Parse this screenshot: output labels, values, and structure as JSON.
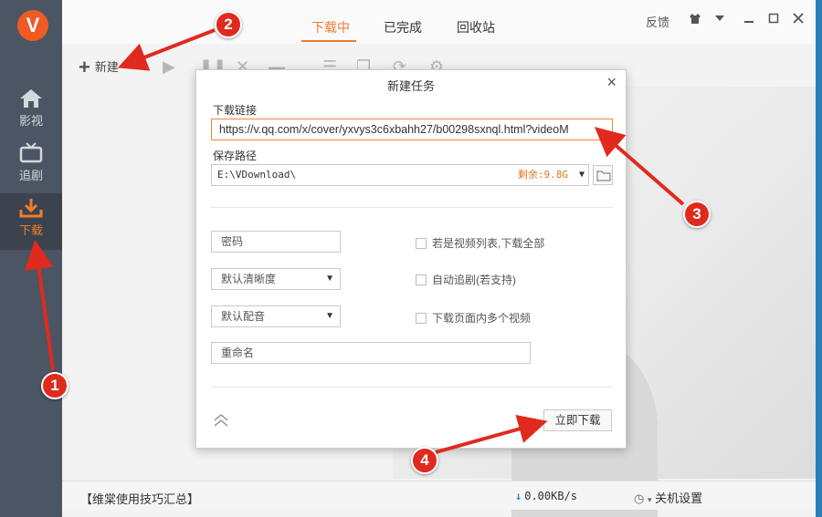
{
  "app": {
    "logo_text": "V",
    "sidebar": [
      {
        "label": "影视",
        "icon": "home-icon"
      },
      {
        "label": "追剧",
        "icon": "tv-icon"
      },
      {
        "label": "下载",
        "icon": "download-icon",
        "active": true
      }
    ],
    "tabs": [
      {
        "label": "下载中",
        "active": true
      },
      {
        "label": "已完成"
      },
      {
        "label": "回收站"
      }
    ],
    "feedback": "反馈",
    "toolbar": {
      "new_label": "新建"
    },
    "accent_color": "#f07c2b"
  },
  "dialog": {
    "title": "新建任务",
    "url_label": "下载链接",
    "url_value": "https://v.qq.com/x/cover/yxvys3c6xbahh27/b00298sxnql.html?videoM",
    "path_label": "保存路径",
    "path_value": "E:\\VDownload\\",
    "free_space": "剩余:9.8G",
    "password_placeholder": "密码",
    "quality_select": "默认清晰度",
    "audio_select": "默认配音",
    "rename_placeholder": "重命名",
    "checkbox_all": "若是视频列表,下载全部",
    "checkbox_follow": "自动追剧(若支持)",
    "checkbox_multi": "下载页面内多个视频",
    "download_now": "立即下载"
  },
  "status": {
    "tip": "【维棠使用技巧汇总】",
    "speed": "0.00KB/s",
    "shutdown": "关机设置"
  },
  "annotations": [
    "1",
    "2",
    "3",
    "4"
  ]
}
